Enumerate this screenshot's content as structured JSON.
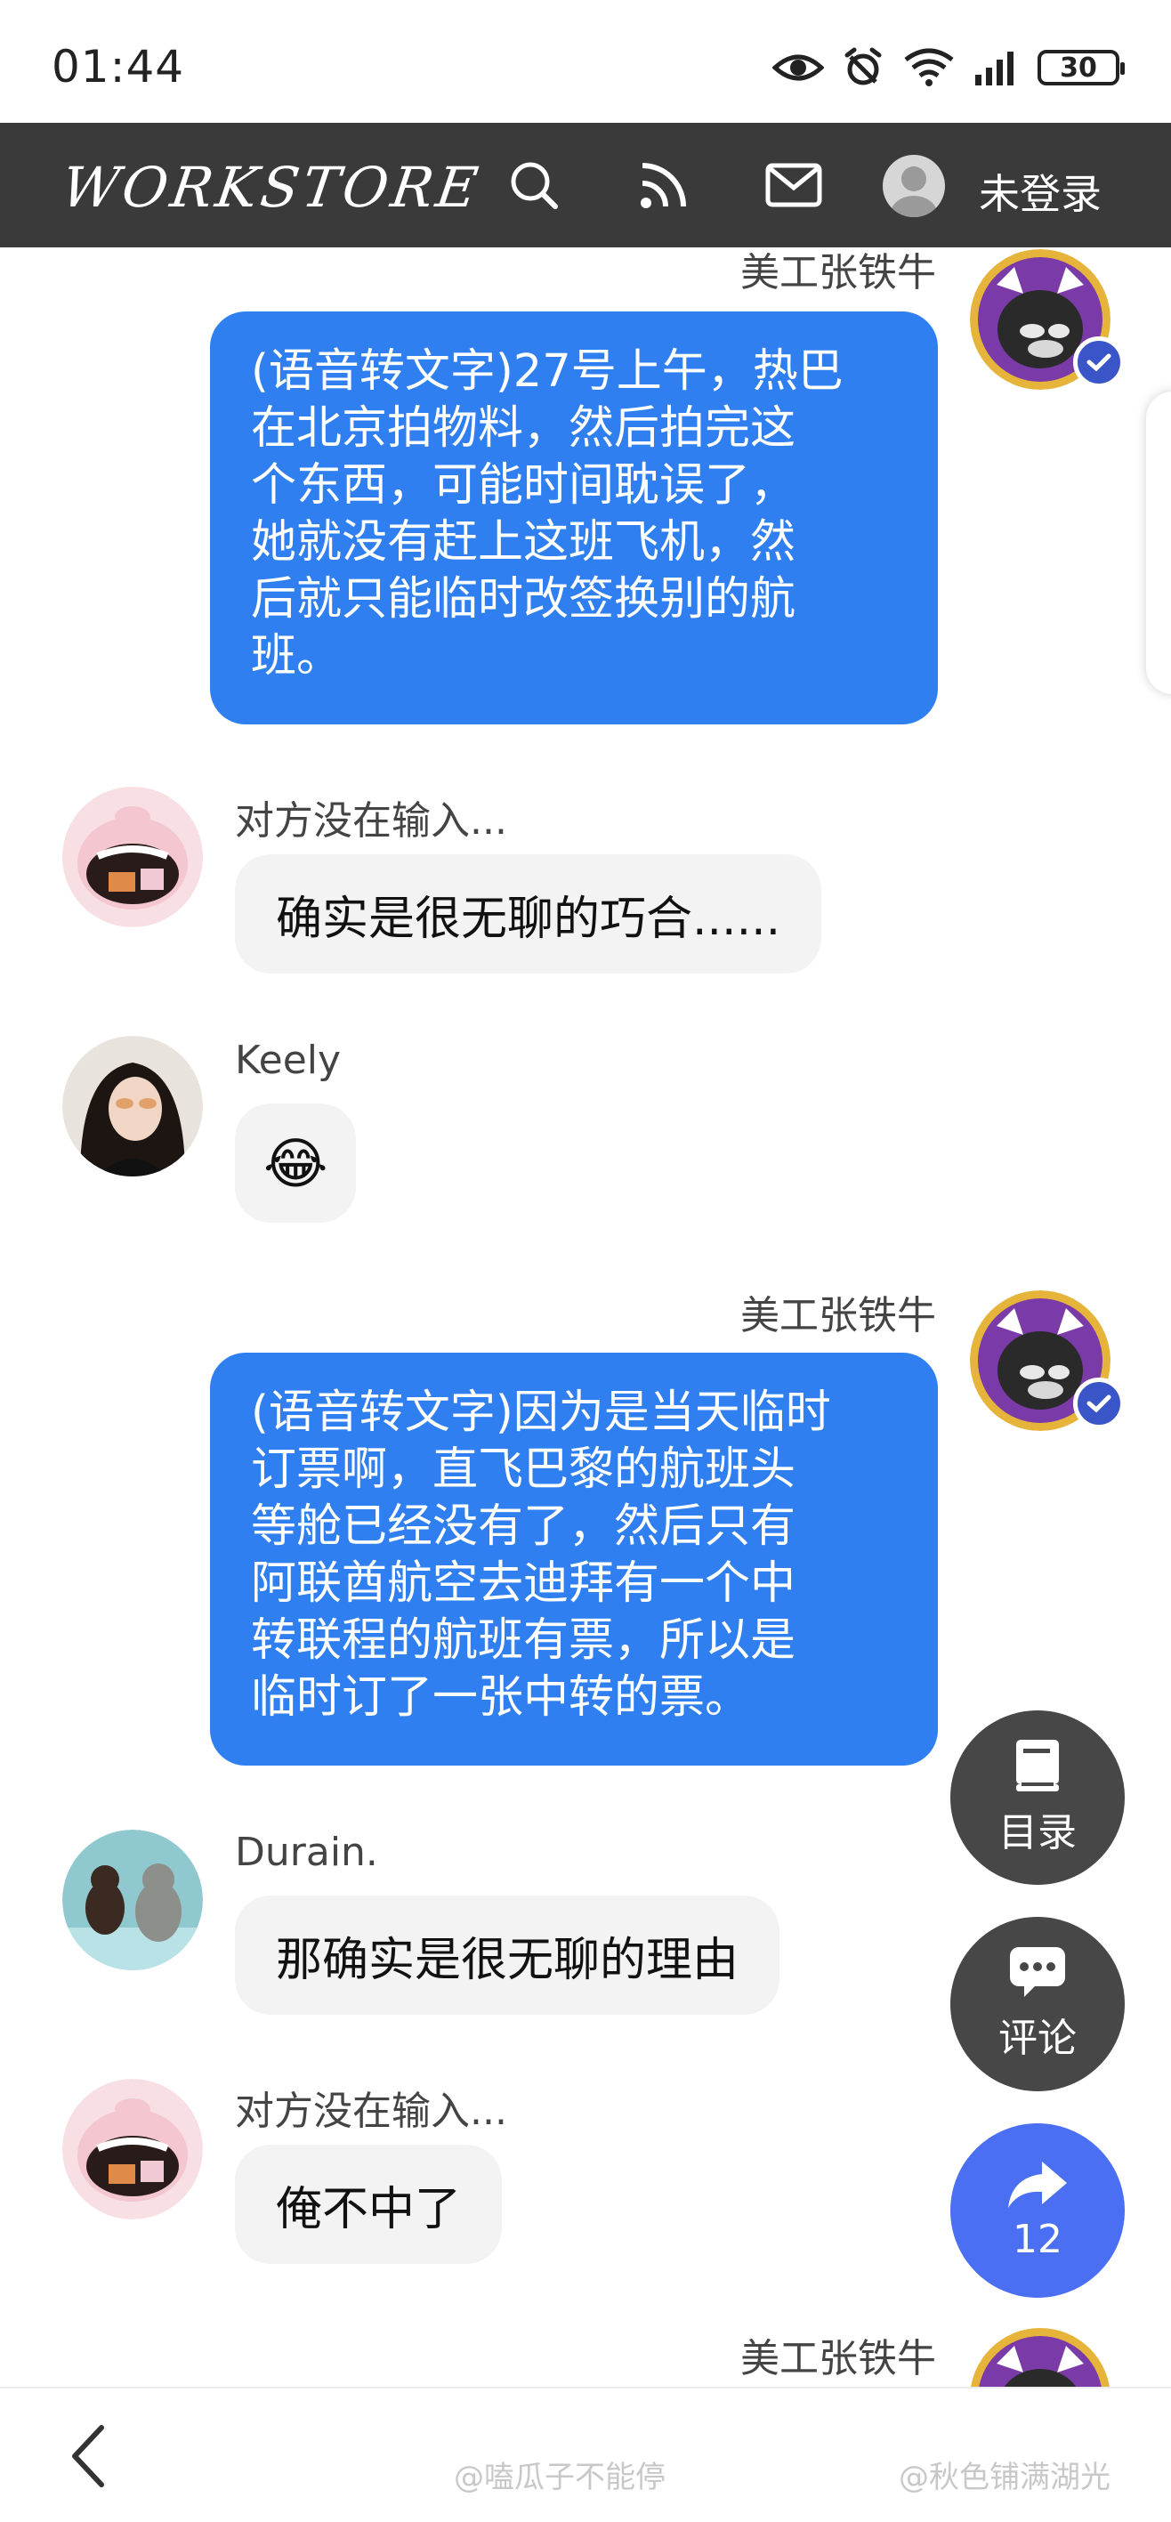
{
  "status_bar": {
    "time": "01:44",
    "battery": "30"
  },
  "nav": {
    "logo": "WORKSTORE",
    "login_label": "未登录"
  },
  "messages": [
    {
      "side": "right",
      "sender": "美工张铁牛",
      "lines": [
        "(语音转文字)27号上午，热巴",
        "在北京拍物料，然后拍完这",
        "个东西，可能时间耽误了，",
        "她就没有赶上这班飞机，然",
        "后就只能临时改签换别的航",
        "班。"
      ]
    },
    {
      "side": "left",
      "sender": "对方没在输入...",
      "text": "确实是很无聊的巧合......"
    },
    {
      "side": "left",
      "sender": "Keely",
      "text": "😂"
    },
    {
      "side": "right",
      "sender": "美工张铁牛",
      "lines": [
        "(语音转文字)因为是当天临时",
        "订票啊，直飞巴黎的航班头",
        "等舱已经没有了，然后只有",
        "阿联酋航空去迪拜有一个中",
        "转联程的航班有票，所以是",
        "临时订了一张中转的票。"
      ]
    },
    {
      "side": "left",
      "sender": "Durain.",
      "text": "那确实是很无聊的理由"
    },
    {
      "side": "left",
      "sender": "对方没在输入...",
      "text": "俺不中了"
    },
    {
      "side": "right",
      "sender": "美工张铁牛"
    }
  ],
  "fabs": {
    "catalog_label": "目录",
    "comment_label": "评论",
    "share_count": "12"
  },
  "watermarks": [
    "@嗑瓜子不能停",
    "@秋色铺满湖光"
  ],
  "colors": {
    "nav_bg": "#3a3a3a",
    "bubble_blue": "#2f7ff0",
    "bubble_gray": "#f3f3f3",
    "share_fab": "#4b6ff2",
    "fab": "#474747"
  },
  "icons": [
    "eye-icon",
    "alarm-icon",
    "wifi-icon",
    "signal-icon",
    "search-icon",
    "rss-icon",
    "mail-icon",
    "book-icon",
    "chat-icon",
    "share-arrow-icon",
    "back-icon",
    "verified-icon"
  ]
}
